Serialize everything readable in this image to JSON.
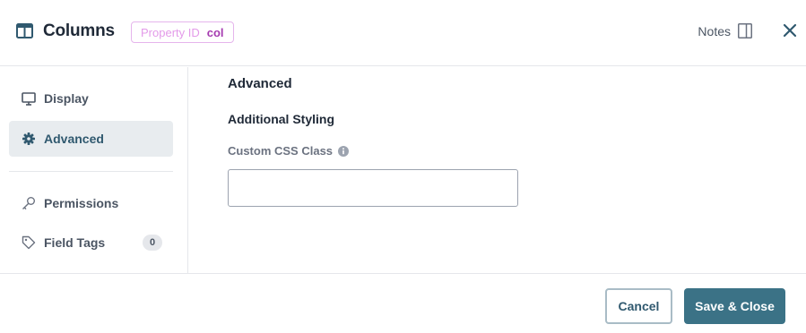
{
  "header": {
    "icon": "columns-icon",
    "title": "Columns",
    "property_id_label": "Property ID",
    "property_id_value": "col",
    "notes_label": "Notes",
    "notes_icon": "sidebar-panel-icon",
    "close_icon": "close-icon"
  },
  "sidebar": {
    "items": [
      {
        "label": "Display",
        "icon": "monitor-icon",
        "active": false
      },
      {
        "label": "Advanced",
        "icon": "gear-icon",
        "active": true
      },
      {
        "label": "Permissions",
        "icon": "key-icon",
        "active": false
      },
      {
        "label": "Field Tags",
        "icon": "tag-icon",
        "active": false,
        "count": "0"
      }
    ]
  },
  "main": {
    "section_title": "Advanced",
    "subsection_title": "Additional Styling",
    "custom_css_label": "Custom CSS Class",
    "custom_css_value": "",
    "custom_css_placeholder": ""
  },
  "footer": {
    "cancel_label": "Cancel",
    "save_label": "Save & Close"
  },
  "colors": {
    "accent": "#3b7286",
    "active_text": "#30596f",
    "badge_border": "#e5b5ec",
    "badge_value": "#a53bb0"
  }
}
